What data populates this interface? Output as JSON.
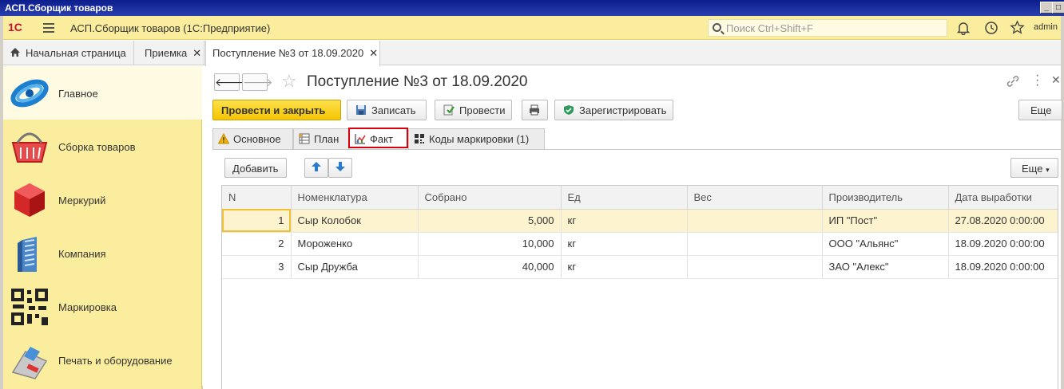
{
  "window": {
    "title": "АСП.Сборщик товаров"
  },
  "topbar": {
    "app_title": "АСП.Сборщик товаров  (1С:Предприятие)",
    "search_placeholder": "Поиск Ctrl+Shift+F",
    "user": "admin"
  },
  "open_tabs": [
    {
      "label": "Начальная страница"
    },
    {
      "label": "Приемка"
    },
    {
      "label": "Поступление №3 от 18.09.2020"
    }
  ],
  "sidebar": {
    "items": [
      {
        "label": "Главное",
        "icon": "globe-icon"
      },
      {
        "label": "Сборка товаров",
        "icon": "basket-icon"
      },
      {
        "label": "Меркурий",
        "icon": "cube-icon"
      },
      {
        "label": "Компания",
        "icon": "building-icon"
      },
      {
        "label": "Маркировка",
        "icon": "qr-code-icon"
      },
      {
        "label": "Печать и оборудование",
        "icon": "pos-terminal-icon"
      }
    ]
  },
  "document": {
    "title": "Поступление №3 от 18.09.2020"
  },
  "toolbar": {
    "post_close": "Провести и закрыть",
    "save": "Записать",
    "post": "Провести",
    "register": "Зарегистрировать",
    "more": "Еще"
  },
  "form_tabs": [
    {
      "label": "Основное"
    },
    {
      "label": "План"
    },
    {
      "label": "Факт"
    },
    {
      "label": "Коды маркировки  (1)"
    }
  ],
  "subtoolbar": {
    "add": "Добавить",
    "more": "Еще"
  },
  "table": {
    "columns": [
      "N",
      "Номенклатура",
      "Собрано",
      "Ед",
      "Вес",
      "Производитель",
      "Дата выработки"
    ],
    "rows": [
      {
        "n": "1",
        "name": "Сыр Колобок",
        "qty": "5,000",
        "unit": "кг",
        "weight": "",
        "producer": "ИП \"Пост\"",
        "date": "27.08.2020 0:00:00"
      },
      {
        "n": "2",
        "name": "Мороженко",
        "qty": "10,000",
        "unit": "кг",
        "weight": "",
        "producer": "ООО \"Альянс\"",
        "date": "18.09.2020 0:00:00"
      },
      {
        "n": "3",
        "name": "Сыр Дружба",
        "qty": "40,000",
        "unit": "кг",
        "weight": "",
        "producer": "ЗАО \"Алекс\"",
        "date": "18.09.2020 0:00:00"
      }
    ]
  },
  "colors": {
    "accent_yellow": "#fbed9e",
    "highlight_red": "#d9000d"
  }
}
